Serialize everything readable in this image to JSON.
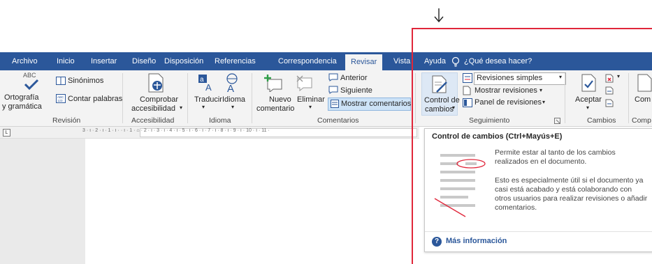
{
  "tabs": {
    "archivo": "Archivo",
    "inicio": "Inicio",
    "insertar": "Insertar",
    "diseno": "Diseño",
    "disposicion": "Disposición",
    "referencias": "Referencias",
    "correspondencia": "Correspondencia",
    "revisar": "Revisar",
    "vista": "Vista",
    "ayuda": "Ayuda",
    "tell_me": "¿Qué desea hacer?"
  },
  "ribbon": {
    "revision": {
      "abc": "ABC",
      "ortografia_1": "Ortografía",
      "ortografia_2": "y gramática",
      "sinonimos": "Sinónimos",
      "contar": "Contar palabras",
      "label": "Revisión"
    },
    "accesibilidad": {
      "comprobar_1": "Comprobar",
      "comprobar_2": "accesibilidad",
      "label": "Accesibilidad"
    },
    "idioma": {
      "traducir": "Traducir",
      "idioma": "Idioma",
      "label": "Idioma"
    },
    "comentarios": {
      "nuevo_1": "Nuevo",
      "nuevo_2": "comentario",
      "eliminar": "Eliminar",
      "anterior": "Anterior",
      "siguiente": "Siguiente",
      "mostrar": "Mostrar comentarios",
      "label": "Comentarios"
    },
    "seguimiento": {
      "control_1": "Control de",
      "control_2": "cambios",
      "revisiones_simples": "Revisiones simples",
      "mostrar_revisiones": "Mostrar revisiones",
      "panel": "Panel de revisiones",
      "label": "Seguimiento"
    },
    "cambios": {
      "aceptar": "Aceptar",
      "label": "Cambios"
    },
    "cut": {
      "com": "Com",
      "comp": "Comp"
    }
  },
  "ruler": {
    "text": "3 · ı · 2 · ı · 1 · ı ·    · ı · 1 · ⌂ · 2 · ı · 3 · ı · 4 · ı · 5 · ı · 6 · ı · 7 · ı · 8 · ı · 9 · ı · 10 · ı · 11 ·"
  },
  "tooltip": {
    "title": "Control de cambios (Ctrl+Mayús+E)",
    "desc1": "Permite estar al tanto de los cambios realizados en el documento.",
    "desc2": "Esto es especialmente útil si el documento ya casi está acabado y está colaborando con otros usuarios para realizar revisiones o añadir comentarios.",
    "more": "Más información"
  },
  "colors": {
    "accent": "#2b579a",
    "highlight": "#e0263a",
    "ribbon_bg": "#f3f3f3"
  }
}
